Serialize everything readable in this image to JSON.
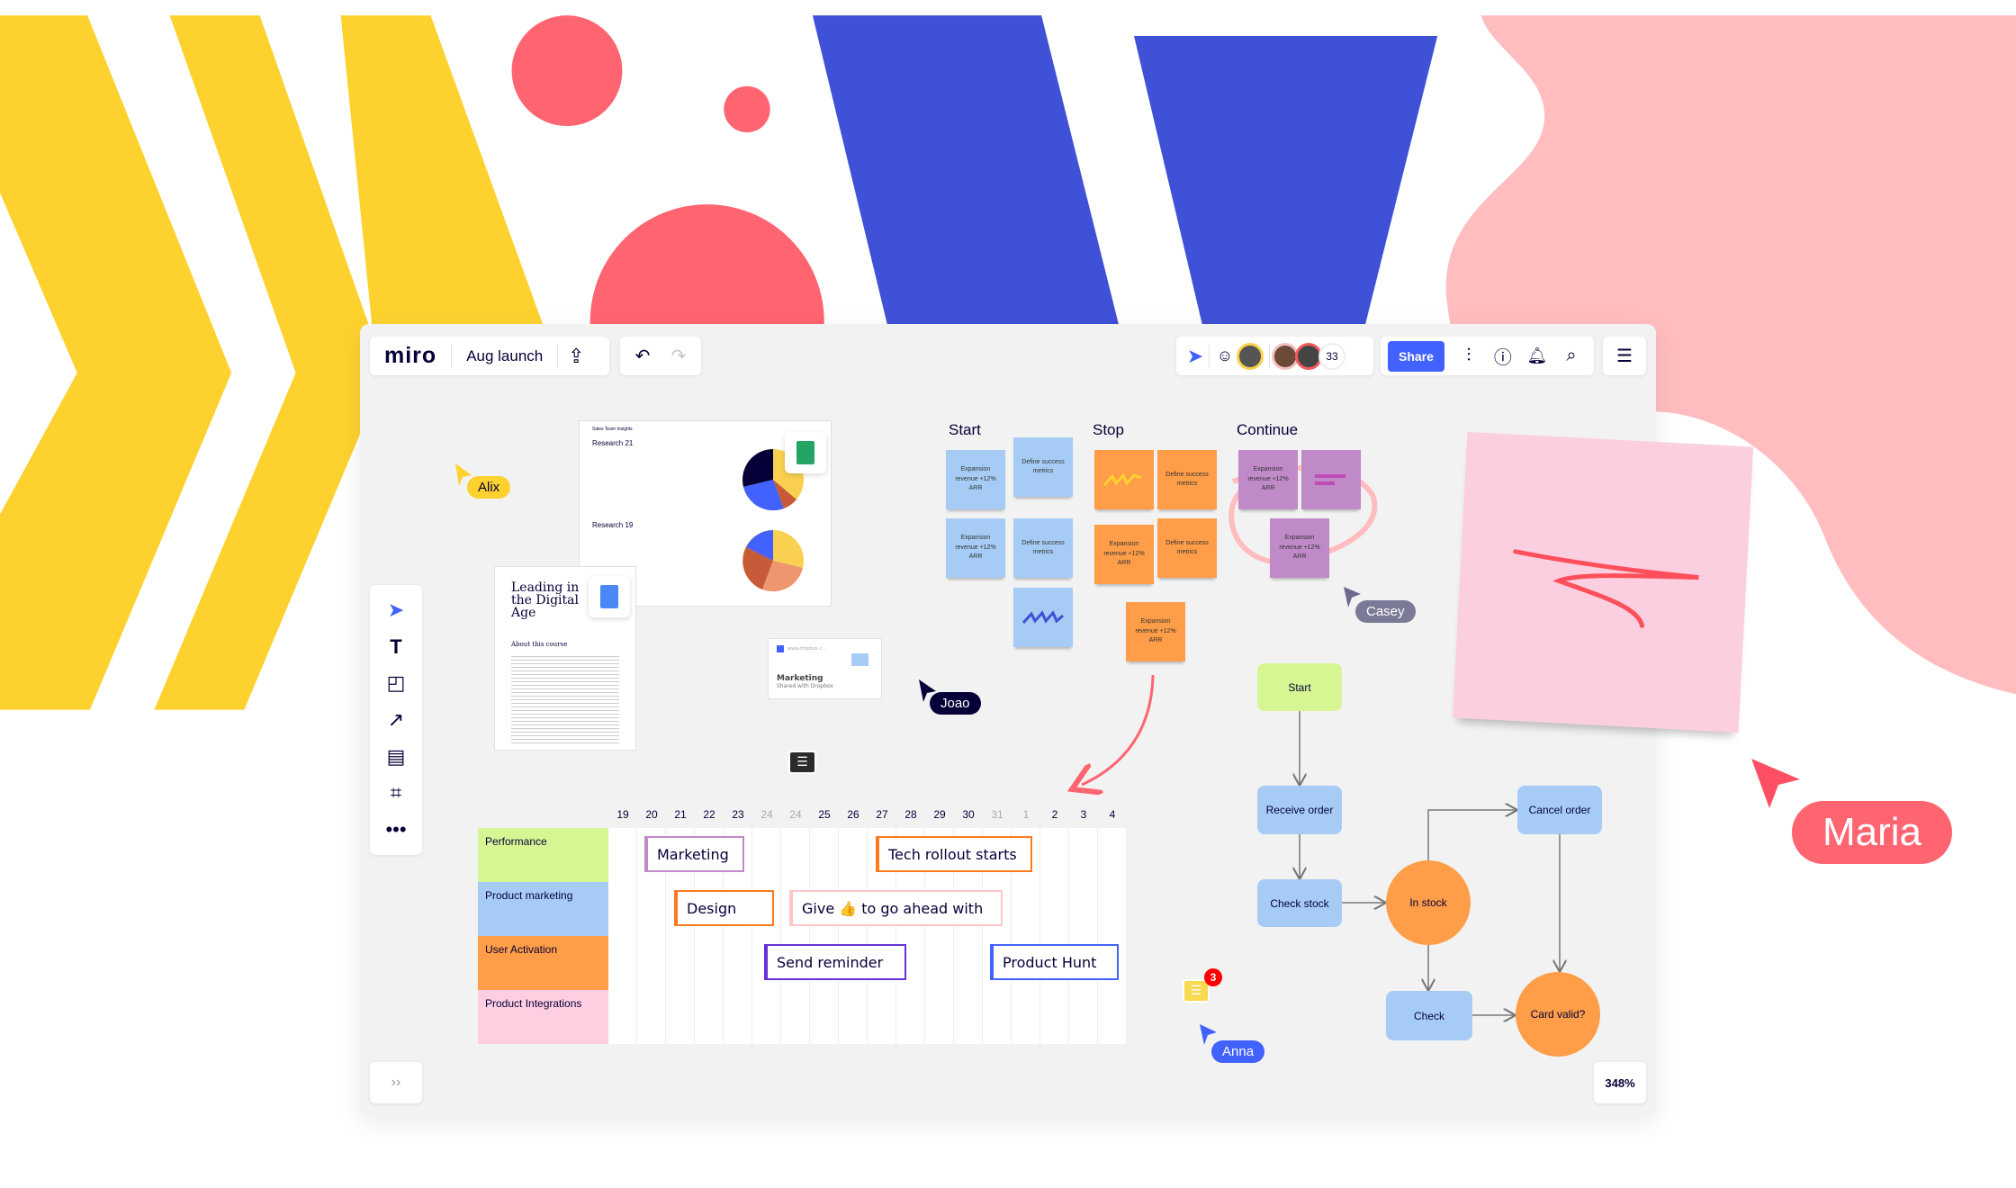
{
  "colors": {
    "accent": "#4262ff",
    "yellow": "#fdd22f",
    "red": "#ff6471",
    "blue": "#3f51d6",
    "pink": "#ffbdbf",
    "sticky_blue": "#a6ccf5",
    "sticky_orange": "#ff9d48",
    "sticky_purple": "#c08ac9",
    "start_green": "#d5f692"
  },
  "topbar": {
    "logo": "miro",
    "board_title": "Aug launch",
    "export_icon": "upload-icon",
    "undo_icon": "undo-icon",
    "redo_icon": "redo-icon",
    "collab": {
      "cursor_icon": "cursor-follow-icon",
      "add_icon": "add-reaction-icon",
      "count": "33"
    },
    "share_label": "Share",
    "settings_icon": "sliders-icon",
    "help_icon": "help-icon",
    "bell_icon": "bell-icon",
    "search_icon": "search-icon",
    "menu_icon": "notes-list-icon"
  },
  "toolbar": {
    "items": [
      "select-cursor",
      "text",
      "sticky-note",
      "pen-arrow",
      "comment",
      "frame",
      "more"
    ]
  },
  "bottom": {
    "expand_label": "››",
    "zoom": "348%"
  },
  "docs": {
    "sheet": {
      "heading": "Sales Team Insights",
      "sections": [
        "Research 21",
        "Research 19"
      ]
    },
    "gdoc": {
      "title": "Leading in the Digital Age",
      "subtitle": "About this course"
    },
    "dropbox": {
      "url": "www.dropbox.c...",
      "title": "Marketing",
      "subtitle": "Shared with Dropbox"
    }
  },
  "retro": {
    "columns": [
      {
        "label": "Start",
        "notes": [
          "Expansion revenue +12% ARR",
          "Define success metrics",
          "Expansion revenue +12% ARR",
          "Define success metrics",
          ""
        ]
      },
      {
        "label": "Stop",
        "notes": [
          "",
          "Define success metrics",
          "Expansion revenue +12% ARR",
          "Define success metrics",
          "Expansion revenue +12% ARR"
        ]
      },
      {
        "label": "Continue",
        "notes": [
          "Expansion revenue +12% ARR",
          "",
          "Expansion revenue +12% ARR"
        ]
      }
    ]
  },
  "cursors": {
    "alix": "Alix",
    "joao": "Joao",
    "casey": "Casey",
    "anna": "Anna",
    "maria": "Maria"
  },
  "comments": {
    "badge": "3"
  },
  "gantt": {
    "dates": [
      "19",
      "20",
      "21",
      "22",
      "23",
      "24",
      "24",
      "25",
      "26",
      "27",
      "28",
      "29",
      "30",
      "31",
      "1",
      "2",
      "3",
      "4"
    ],
    "rows": [
      "Performance",
      "Product marketing",
      "User Activation",
      "Product Integrations"
    ],
    "bars": [
      {
        "label": "Marketing",
        "color": "#c08ac9"
      },
      {
        "label": "Tech rollout starts",
        "color": "#fa7a1e"
      },
      {
        "label": "Design",
        "color": "#fa7a1e"
      },
      {
        "label": "Give 👍 to go ahead with",
        "color": "#ffc6c6"
      },
      {
        "label": "Send reminder",
        "color": "#6631d7"
      },
      {
        "label": "Product Hunt",
        "color": "#4262ff"
      }
    ]
  },
  "flow": {
    "start": "Start",
    "receive": "Receive order",
    "check_stock": "Check stock",
    "in_stock": "In stock",
    "cancel": "Cancel order",
    "check": "Check",
    "card_valid": "Card valid?"
  }
}
